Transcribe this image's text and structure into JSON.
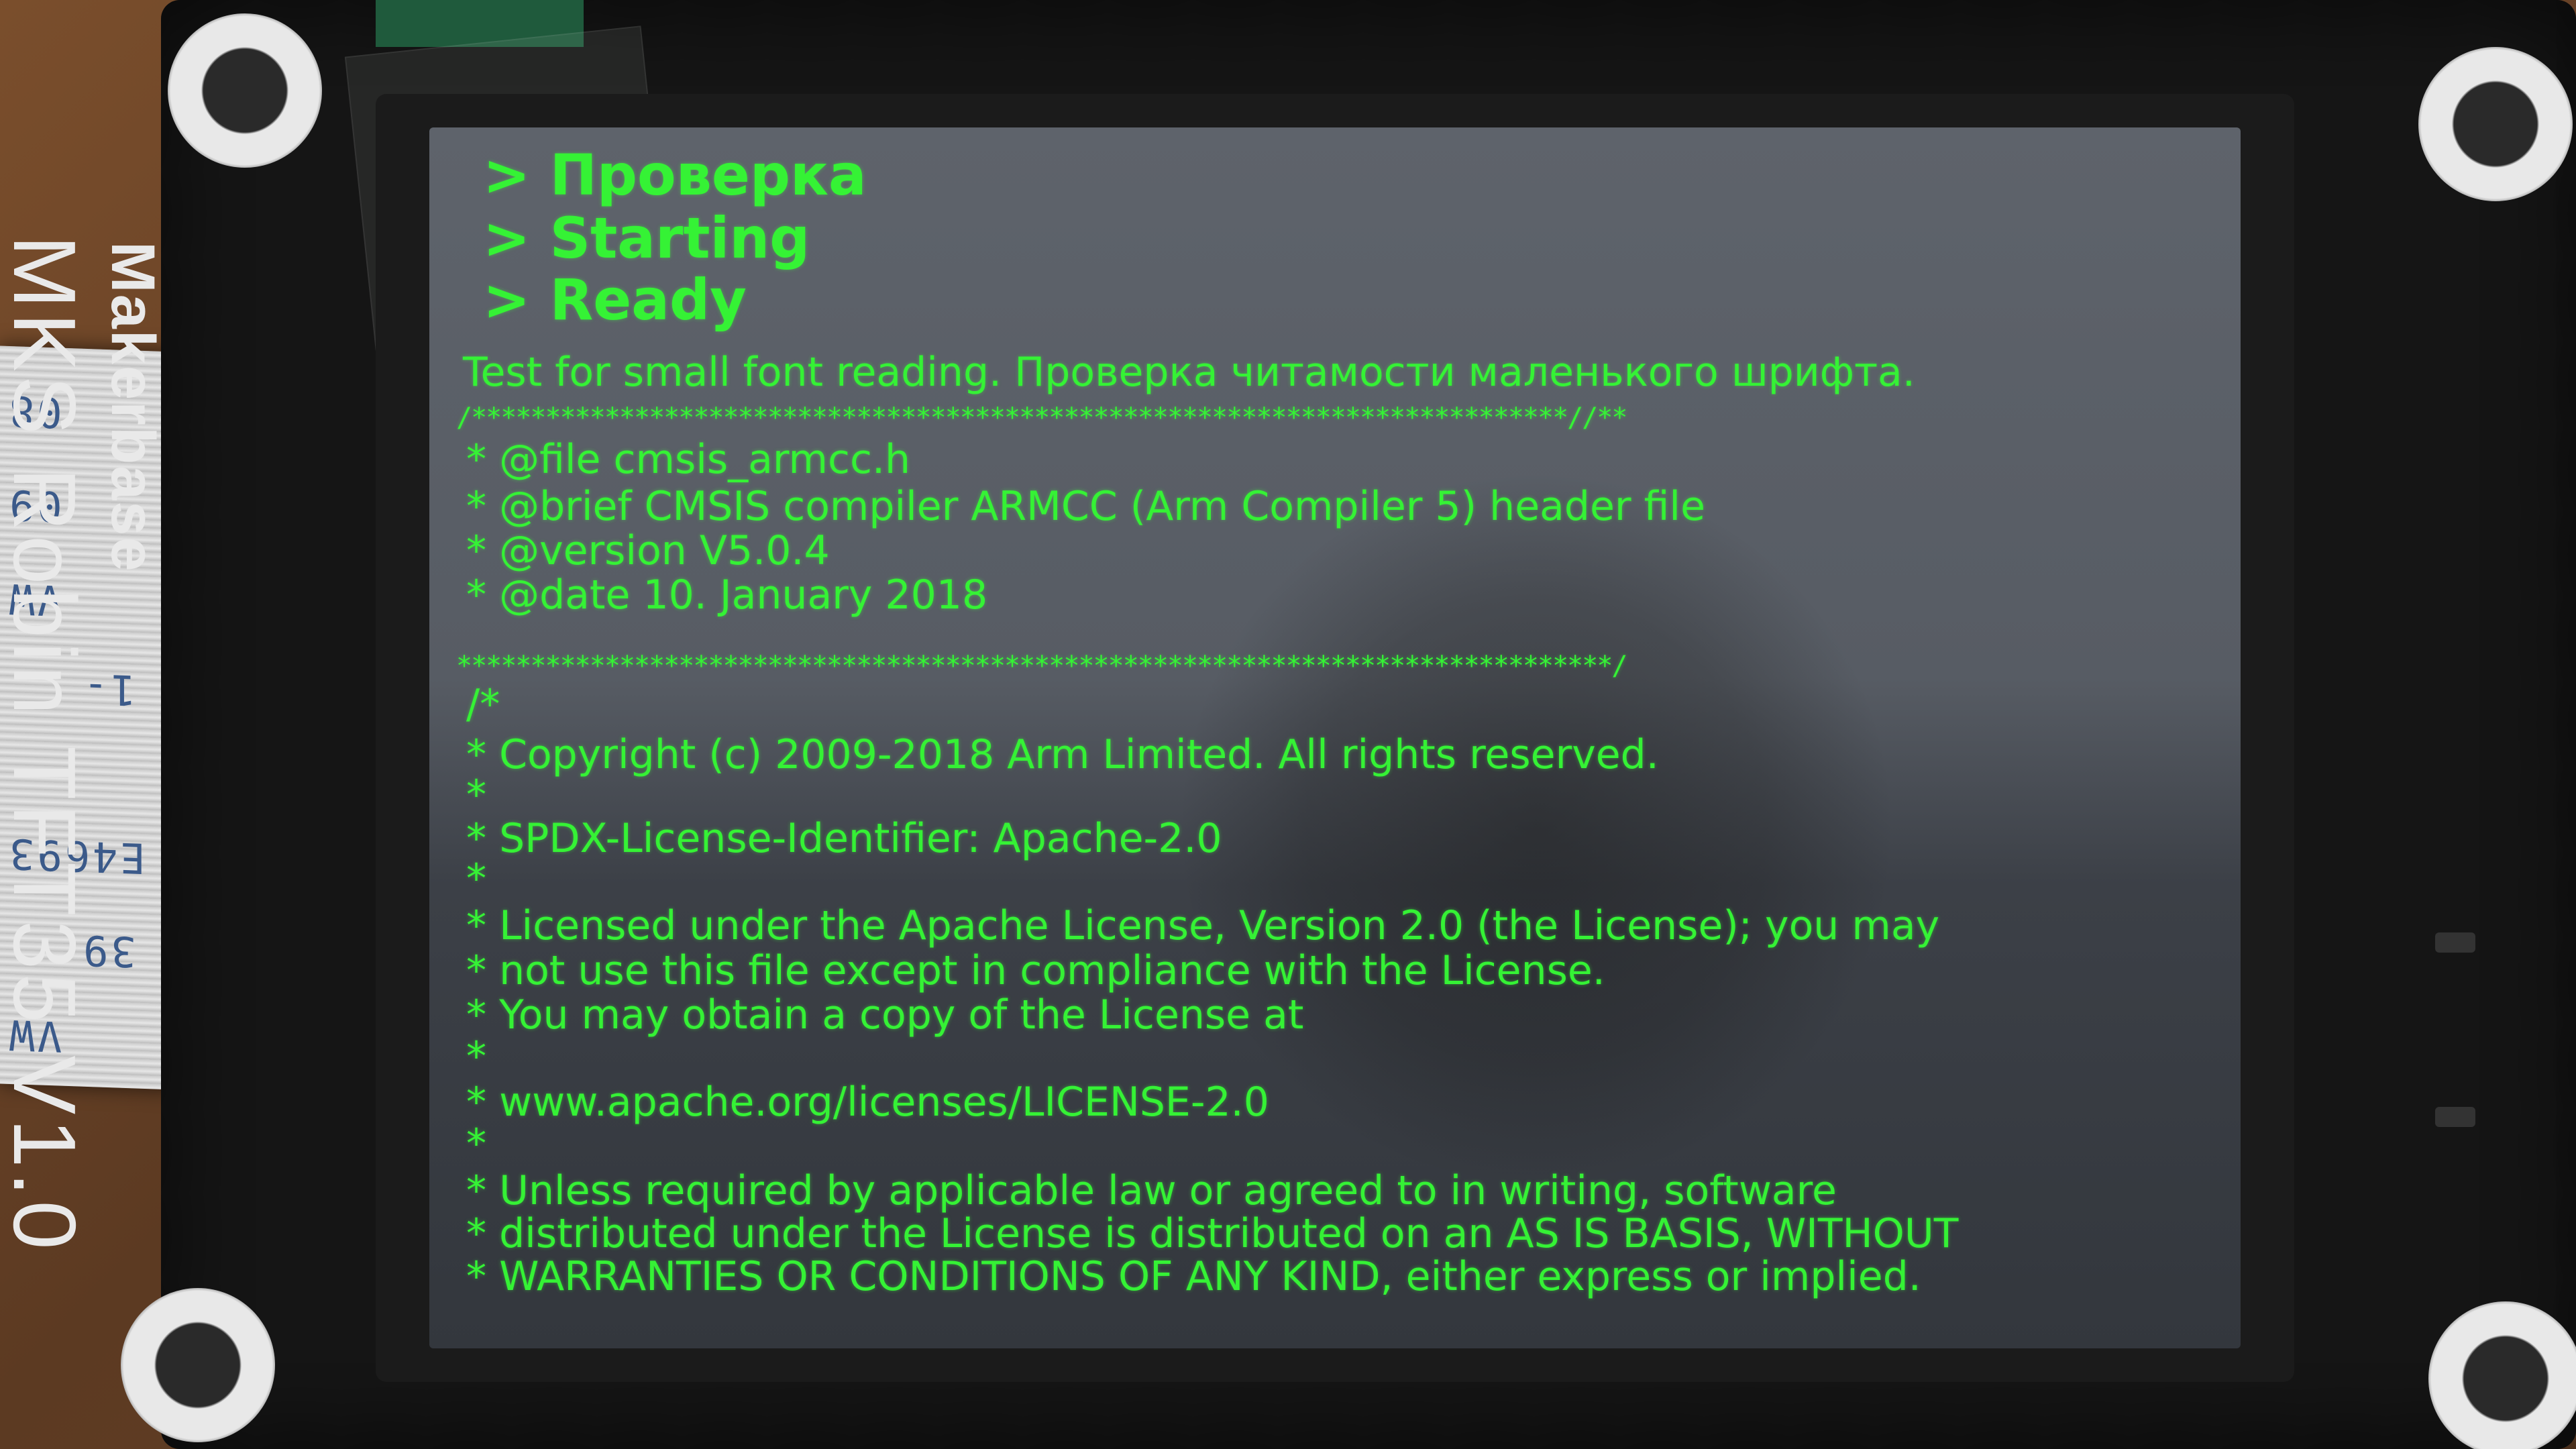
{
  "board": {
    "maker": "Makerbase",
    "model": "MKS Robin TFT35 V1.0"
  },
  "ribbon_labels": [
    "08",
    "09",
    "VW",
    "1-",
    "E4693",
    "39",
    "VW"
  ],
  "screen": {
    "headers": [
      "> Проверка",
      "> Starting",
      "> Ready"
    ],
    "small_font_test": "Test for small font reading. Провeрка читамости малeнького шрифта.",
    "separator_top": "/**************************************************************************//**",
    "file_line": " * @file     cmsis_armcc.h",
    "brief_line": " * @brief    CMSIS compiler ARMCC (Arm Compiler 5) header file",
    "version_line": " * @version  V5.0.4",
    "date_line": " * @date     10. January 2018",
    "separator_bottom": " ******************************************************************************/",
    "comment_open": "/*",
    "copyright_line": " * Copyright (c) 2009-2018 Arm Limited. All rights reserved.",
    "blank_1": " *",
    "spdx_line": " * SPDX-License-Identifier: Apache-2.0",
    "blank_2": " *",
    "license_line_1": " * Licensed under the Apache License, Version 2.0 (the License); you may",
    "license_line_2": " * not use this file except in compliance with the License.",
    "license_line_3": " * You may obtain a copy of the License at",
    "blank_3": " *",
    "url_line": " * www.apache.org/licenses/LICENSE-2.0",
    "blank_4": " *",
    "unless_line_1": " * Unless required by applicable law or agreed to in writing, software",
    "unless_line_2": " * distributed under the License is distributed on an AS IS BASIS, WITHOUT",
    "unless_line_3": " * WARRANTIES OR CONDITIONS OF ANY KIND, either express or implied."
  },
  "colors": {
    "text_green": "#35f235",
    "screen_gray": "#5e636b",
    "board_black": "#151515"
  }
}
